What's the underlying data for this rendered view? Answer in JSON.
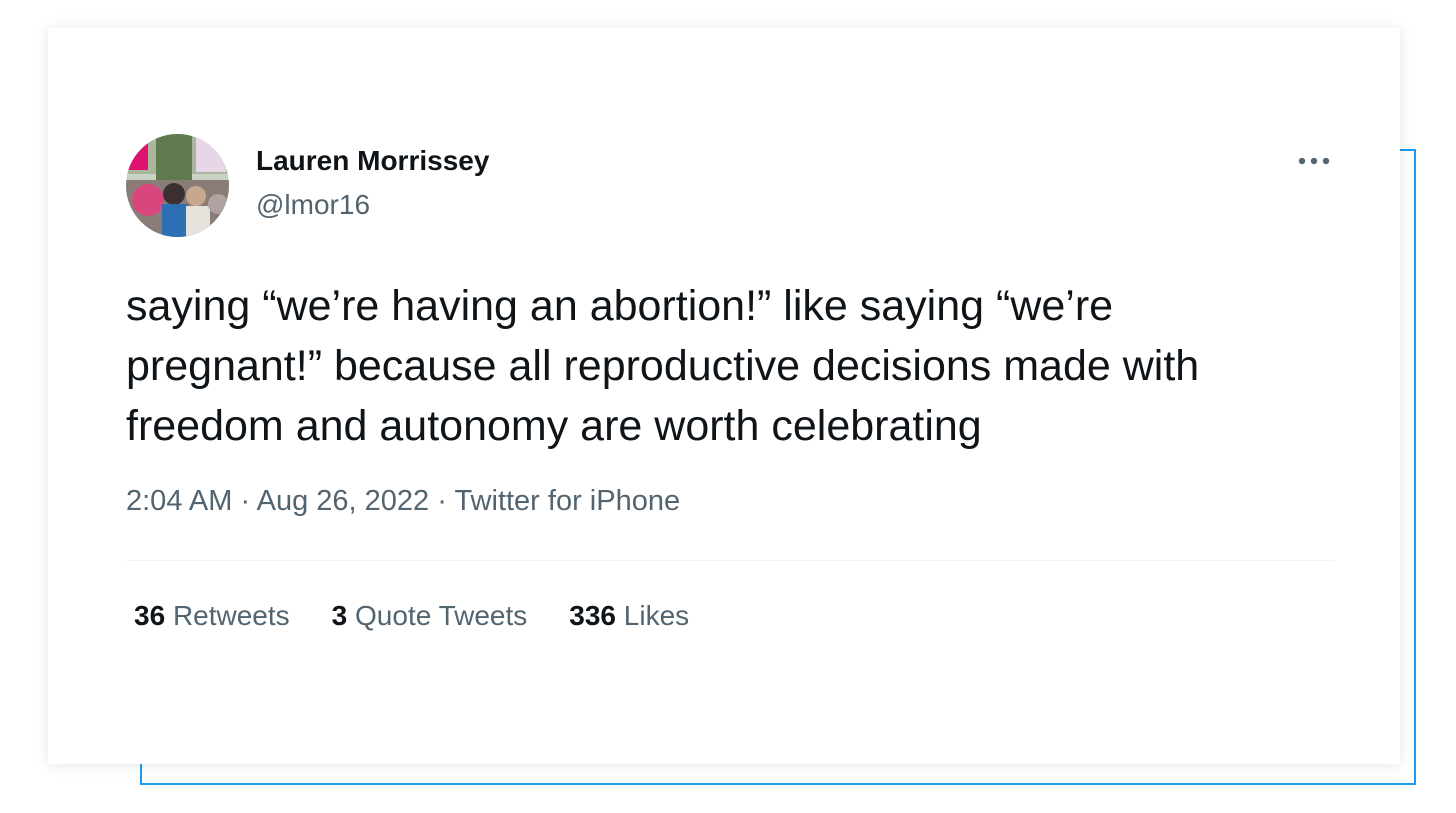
{
  "tweet": {
    "author": {
      "display_name": "Lauren Morrissey",
      "handle": "@lmor16"
    },
    "more_icon": "more-horizontal-icon",
    "text": "saying “we’re having an abortion!” like saying “we’re pregnant!” because all reproductive decisions made with freedom and autonomy are worth celebrating",
    "meta": {
      "time": "2:04 AM",
      "separator": "·",
      "date": "Aug 26, 2022",
      "source": "Twitter for iPhone"
    },
    "stats": {
      "retweets_count": "36",
      "retweets_label": "Retweets",
      "quotes_count": "3",
      "quotes_label": "Quote Tweets",
      "likes_count": "336",
      "likes_label": "Likes"
    }
  },
  "colors": {
    "accent": "#1d9bf0",
    "text_primary": "#0f1419",
    "text_secondary": "#536471",
    "divider": "#eff3f4"
  }
}
